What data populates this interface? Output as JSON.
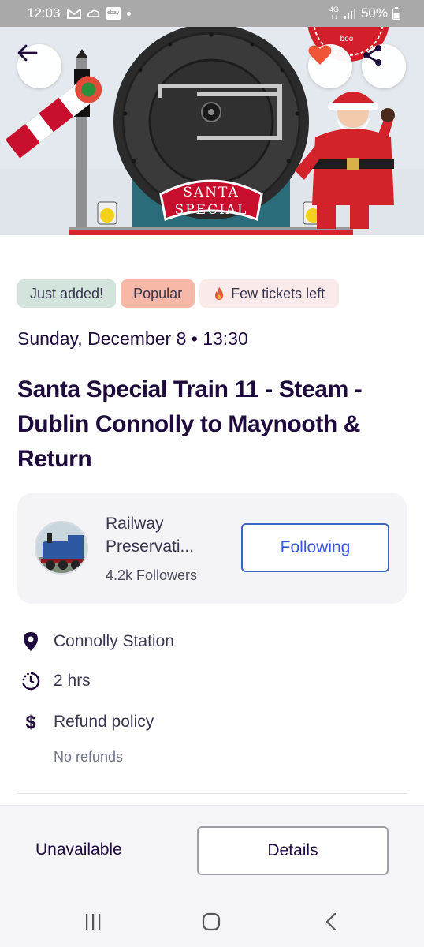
{
  "status_bar": {
    "time": "12:03",
    "network": "4G",
    "battery": "50%",
    "left_icons": [
      "gmail-icon",
      "cloud-icon",
      "ebay-icon",
      "dot-icon"
    ],
    "ebay_badge": "ebay"
  },
  "hero": {
    "sign_line1": "SANTA",
    "sign_line2": "SPECIAL",
    "corner_text": "boo",
    "colors": {
      "sky": "#e4eaf0",
      "engine": "#2b2b2b",
      "sign": "#c8102e",
      "santa": "#d3232a"
    }
  },
  "badges": [
    {
      "label": "Just added!"
    },
    {
      "label": "Popular"
    },
    {
      "label": "Few tickets left",
      "icon": "fire-icon"
    }
  ],
  "event": {
    "date": "Sunday, December 8 • 13:30",
    "title": "Santa Special Train 11 - Steam - Dublin Connolly to Maynooth & Return"
  },
  "organizer": {
    "name_line1": "Railway",
    "name_line2": "Preservati...",
    "followers": "4.2k Followers",
    "follow_label": "Following"
  },
  "info": {
    "location": "Connolly Station",
    "duration": "2 hrs",
    "refund_label": "Refund policy",
    "refund_detail": "No refunds"
  },
  "footer": {
    "status": "Unavailable",
    "details_label": "Details"
  },
  "colors": {
    "primary_text": "#1e0a3c",
    "accent_blue": "#3659e3",
    "heart": "#f05537",
    "badge_new": "#d3e4dc",
    "badge_popular": "#f7b8a8",
    "badge_few": "#fbeaea"
  }
}
